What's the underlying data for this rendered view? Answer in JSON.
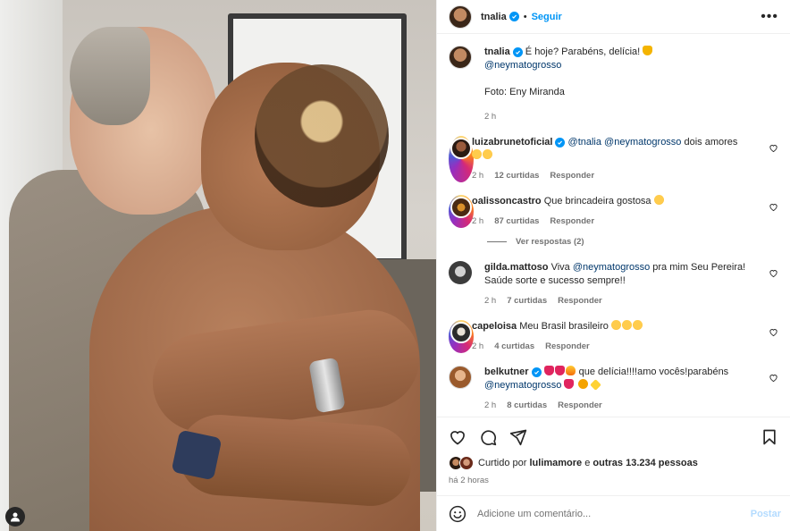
{
  "header": {
    "username": "tnalia",
    "separator": "•",
    "follow_label": "Seguir",
    "more_label": "•••"
  },
  "caption": {
    "username": "tnalia",
    "text": "É hoje? Parabéns, delícia!",
    "mention": "@neymatogrosso",
    "credit": "Foto: Eny Miranda",
    "time": "2 h"
  },
  "comments": [
    {
      "username": "luizabrunetoficial",
      "verified": true,
      "mentions": "@tnalia @neymatogrosso",
      "text": "dois amores",
      "time": "2 h",
      "likes": "12 curtidas",
      "reply": "Responder"
    },
    {
      "username": "oalissoncastro",
      "verified": false,
      "text": "Que brincadeira gostosa",
      "time": "2 h",
      "likes": "87 curtidas",
      "reply": "Responder"
    },
    {
      "username": "gilda.mattoso",
      "verified": false,
      "text_before": "Viva",
      "mention": "@neymatogrosso",
      "text_after": "pra mim Seu Pereira! Saúde sorte e sucesso sempre!!",
      "time": "2 h",
      "likes": "7 curtidas",
      "reply": "Responder"
    },
    {
      "username": "capeloisa",
      "verified": false,
      "text": "Meu Brasil brasileiro",
      "time": "2 h",
      "likes": "4 curtidas",
      "reply": "Responder"
    },
    {
      "username": "belkutner",
      "verified": true,
      "text": "que delícia!!!!amo vocês!parabéns",
      "mention": "@neymatogrosso",
      "time": "2 h",
      "likes": "8 curtidas",
      "reply": "Responder"
    }
  ],
  "view_replies": "Ver respostas (2)",
  "likes": {
    "prefix": "Curtido por",
    "user": "lulimamore",
    "middle": "e",
    "others": "outras 13.234 pessoas"
  },
  "post_time": "há 2 horas",
  "add_comment": {
    "placeholder": "Adicione um comentário...",
    "post_label": "Postar"
  },
  "colors": {
    "accent": "#0095f6",
    "mention": "#00376b",
    "muted": "#737373",
    "post_disabled": "#b3dbff"
  },
  "icons": [
    "user-icon",
    "verified-icon",
    "more-icon",
    "heart-icon",
    "comment-icon",
    "share-icon",
    "bookmark-icon",
    "emoji-icon"
  ]
}
